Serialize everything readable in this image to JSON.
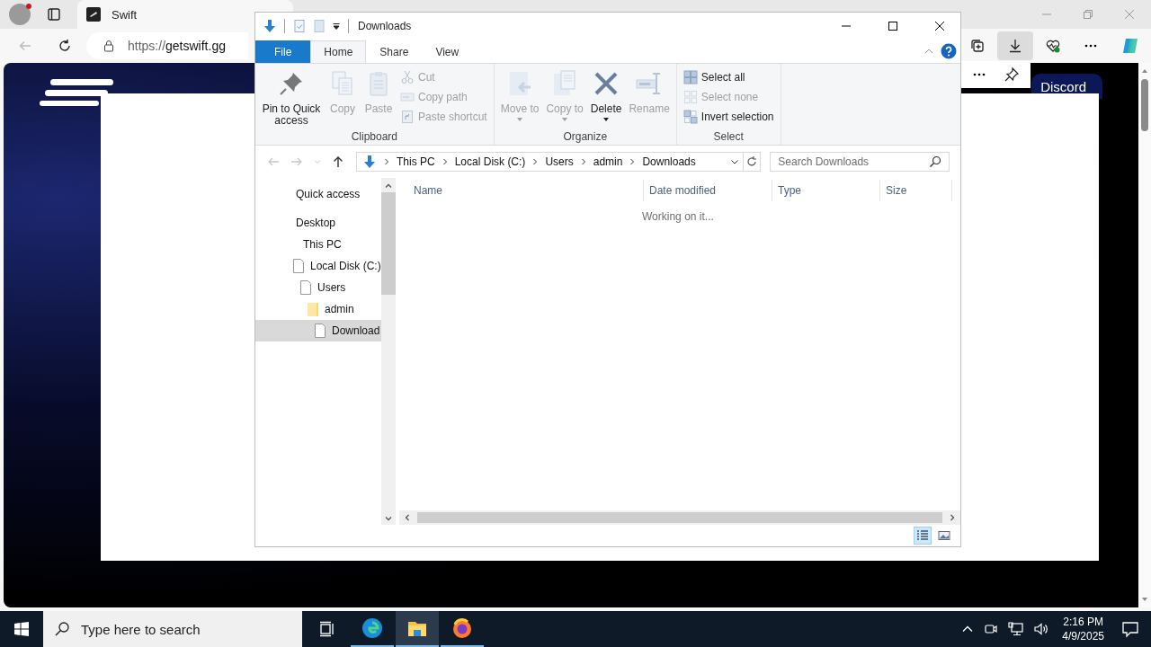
{
  "browser": {
    "tab": {
      "title": "Swift"
    },
    "address": {
      "scheme": "https://",
      "host": "getswift.gg"
    },
    "page": {
      "button": "Discord"
    }
  },
  "explorer": {
    "title": "Downloads",
    "ribbon_tabs": [
      {
        "label": "File",
        "kind": "menu",
        "selected": false
      },
      {
        "label": "Home",
        "kind": "tab",
        "selected": true
      },
      {
        "label": "Share",
        "kind": "tab",
        "selected": false
      },
      {
        "label": "View",
        "kind": "tab",
        "selected": false
      }
    ],
    "groups": [
      {
        "label": "Clipboard",
        "large": [
          {
            "label": "Pin to Quick access",
            "disabled": false,
            "dropdown": false
          },
          {
            "label": "Copy",
            "disabled": true,
            "dropdown": false
          },
          {
            "label": "Paste",
            "disabled": true,
            "dropdown": false
          }
        ],
        "small": [
          {
            "label": "Cut",
            "disabled": true
          },
          {
            "label": "Copy path",
            "disabled": true
          },
          {
            "label": "Paste shortcut",
            "disabled": true
          }
        ]
      },
      {
        "label": "Organize",
        "large": [
          {
            "label": "Move to",
            "disabled": true,
            "dropdown": true
          },
          {
            "label": "Copy to",
            "disabled": true,
            "dropdown": true
          },
          {
            "label": "Delete",
            "disabled": false,
            "dropdown": true
          },
          {
            "label": "Rename",
            "disabled": true,
            "dropdown": false
          }
        ]
      },
      {
        "label": "Select",
        "small": [
          {
            "label": "Select all",
            "disabled": false
          },
          {
            "label": "Select none",
            "disabled": true
          },
          {
            "label": "Invert selection",
            "disabled": false
          }
        ]
      }
    ],
    "breadcrumb": [
      "This PC",
      "Local Disk (C:)",
      "Users",
      "admin",
      "Downloads"
    ],
    "search": {
      "placeholder": "Search Downloads"
    },
    "nav": [
      {
        "label": "Quick access",
        "kind": "plain",
        "selected": false
      },
      {
        "label": "Desktop",
        "kind": "plain",
        "selected": false,
        "children": [
          {
            "label": "This PC",
            "kind": "plain",
            "selected": false,
            "children": [
              {
                "label": "Local Disk (C:)",
                "kind": "file",
                "selected": false,
                "children": [
                  {
                    "label": "Users",
                    "kind": "file",
                    "selected": false,
                    "children": [
                      {
                        "label": "admin",
                        "kind": "folder",
                        "selected": false,
                        "children": [
                          {
                            "label": "Download",
                            "kind": "file",
                            "selected": true
                          }
                        ]
                      }
                    ]
                  }
                ]
              }
            ]
          }
        ]
      }
    ],
    "columns": [
      "Name",
      "Date modified",
      "Type",
      "Size"
    ],
    "status": "Working on it...",
    "view_buttons": [
      {
        "kind": "details",
        "selected": true
      },
      {
        "kind": "large_icons",
        "selected": false
      }
    ]
  },
  "taskbar": {
    "search": {
      "placeholder": "Type here to search"
    },
    "clock": {
      "time": "2:16 PM",
      "date": "4/9/2025"
    }
  }
}
